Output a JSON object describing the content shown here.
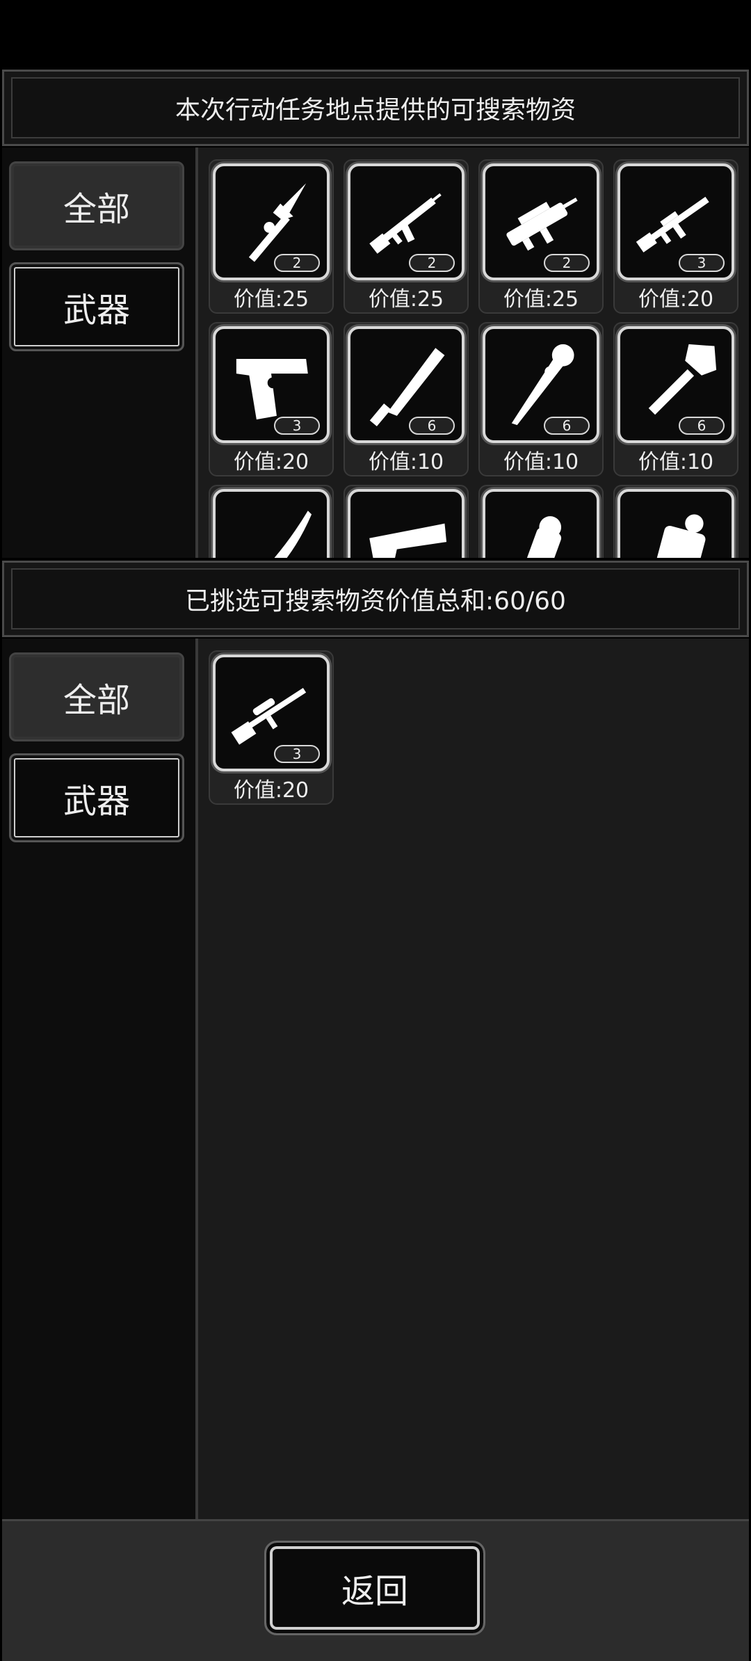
{
  "available": {
    "title": "本次行动任务地点提供的可搜索物资",
    "tabs": {
      "all": "全部",
      "weapon": "武器"
    },
    "items": [
      {
        "icon": "spear-icon",
        "count": "2",
        "value": "价值:25"
      },
      {
        "icon": "assault-rifle-icon",
        "count": "2",
        "value": "价值:25"
      },
      {
        "icon": "bullpup-rifle-icon",
        "count": "2",
        "value": "价值:25"
      },
      {
        "icon": "m16-rifle-icon",
        "count": "3",
        "value": "价值:20"
      },
      {
        "icon": "pistol-icon",
        "count": "3",
        "value": "价值:20"
      },
      {
        "icon": "machete-icon",
        "count": "6",
        "value": "价值:10"
      },
      {
        "icon": "spiked-bat-icon",
        "count": "6",
        "value": "价值:10"
      },
      {
        "icon": "shovel-icon",
        "count": "6",
        "value": "价值:10"
      },
      {
        "icon": "curved-blade-icon"
      },
      {
        "icon": "desert-eagle-icon"
      },
      {
        "icon": "grenade-icon"
      },
      {
        "icon": "canister-icon"
      }
    ]
  },
  "selected": {
    "title": "已挑选可搜索物资价值总和:60/60",
    "tabs": {
      "all": "全部",
      "weapon": "武器"
    },
    "items": [
      {
        "icon": "sniper-rifle-icon",
        "count": "3",
        "value": "价值:20"
      }
    ]
  },
  "footer": {
    "back_label": "返回"
  }
}
